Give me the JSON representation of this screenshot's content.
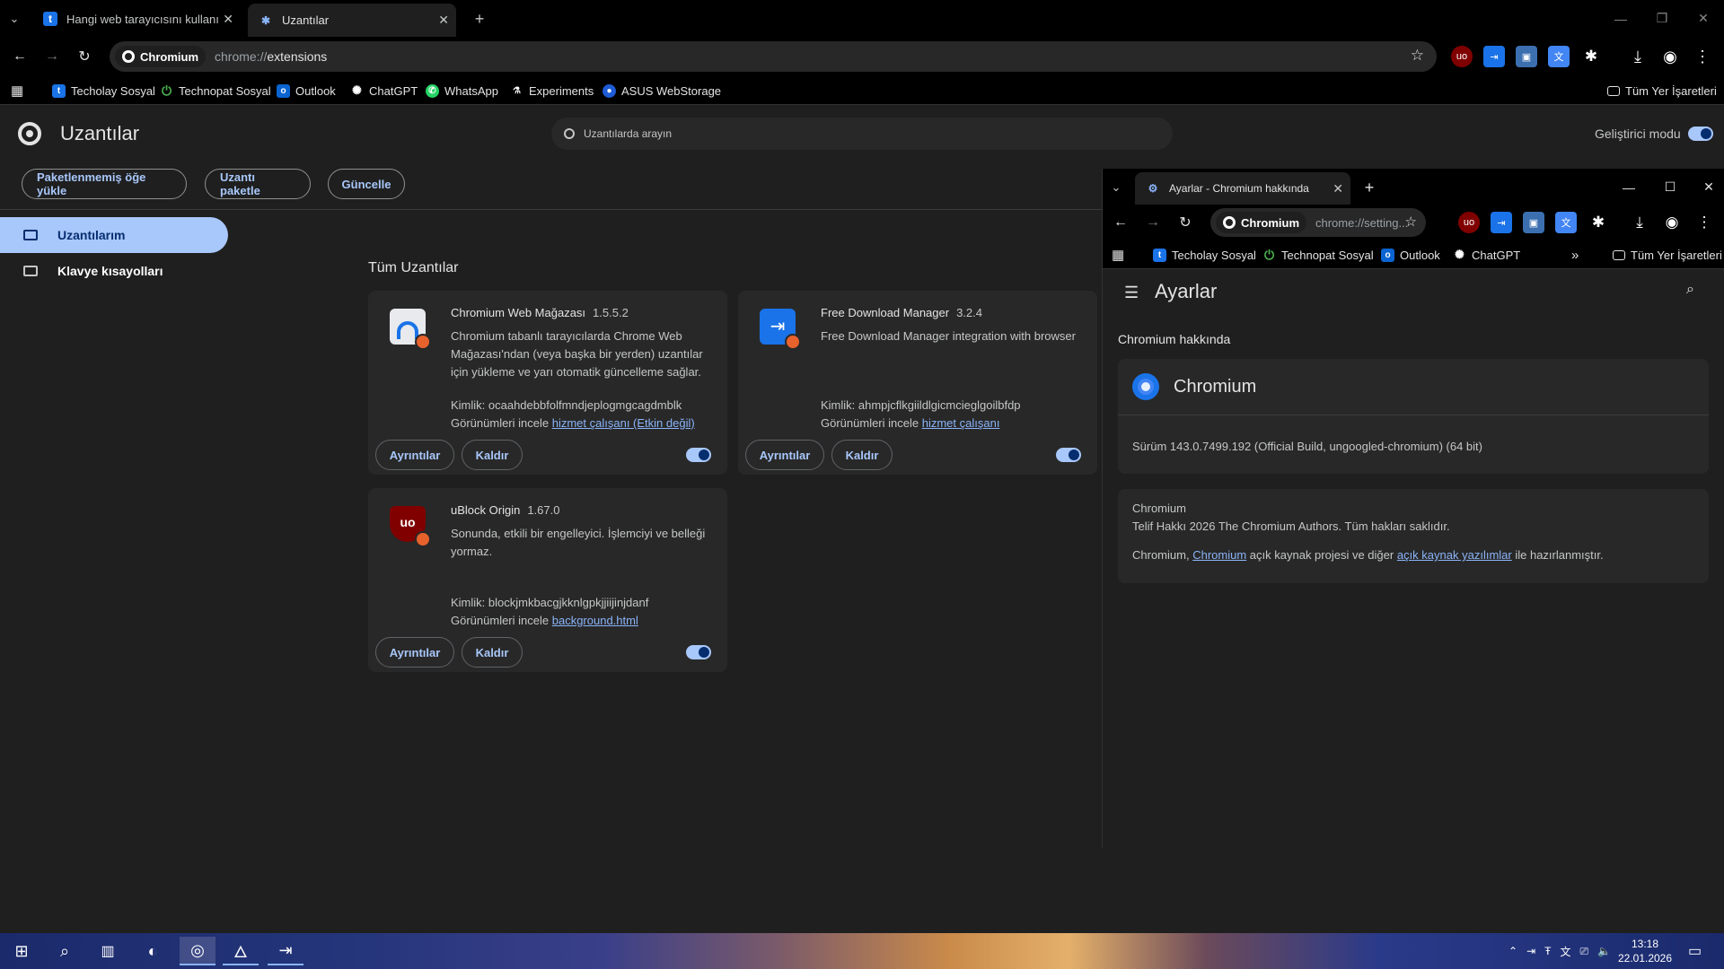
{
  "tabs": [
    {
      "title": "Hangi web tarayıcısını kullanıyo"
    },
    {
      "title": "Uzantılar"
    }
  ],
  "omnibox": {
    "chip": "Chromium",
    "url_prefix": "chrome://",
    "url_path": "extensions"
  },
  "bookmarks": [
    "Techolay Sosyal",
    "Technopat Sosyal",
    "Outlook",
    "ChatGPT",
    "WhatsApp",
    "Experiments",
    "ASUS WebStorage"
  ],
  "all_bookmarks": "Tüm Yer İşaretleri",
  "page": {
    "title": "Uzantılar",
    "search_placeholder": "Uzantılarda arayın",
    "dev_mode_label": "Geliştirici modu",
    "dev_mode_on": true,
    "buttons": [
      "Paketlenmemiş öğe yükle",
      "Uzantı paketle",
      "Güncelle"
    ],
    "sidebar": [
      {
        "label": "Uzantılarım",
        "active": true
      },
      {
        "label": "Klavye kısayolları",
        "active": false
      }
    ],
    "section_title": "Tüm Uzantılar"
  },
  "extensions": [
    {
      "name": "Chromium Web Mağazası",
      "version": "1.5.5.2",
      "description": "Chromium tabanlı tarayıcılarda Chrome Web Mağazası'ndan (veya başka bir yerden) uzantılar için yükleme ve yarı otomatik güncelleme sağlar.",
      "id_label": "Kimlik: ocaahdebbfolfmndjeplogmgcagdmblk",
      "views_label": "Görünümleri incele",
      "views_link": "hizmet çalışanı (Etkin değil)",
      "details": "Ayrıntılar",
      "remove": "Kaldır",
      "enabled": true
    },
    {
      "name": "Free Download Manager",
      "version": "3.2.4",
      "description": "Free Download Manager integration with browser",
      "id_label": "Kimlik: ahmpjcflkgiildlgicmcieglgoilbfdp",
      "views_label": "Görünümleri incele",
      "views_link": "hizmet çalışanı",
      "details": "Ayrıntılar",
      "remove": "Kaldır",
      "enabled": true
    },
    {
      "name": "uBlock Origin",
      "version": "1.67.0",
      "description": "Sonunda, etkili bir engelleyici. İşlemciyi ve belleği yormaz.",
      "id_label": "Kimlik: blockjmkbacgjkknlgpkjjiijinjdanf",
      "views_label": "Görünümleri incele",
      "views_link": "background.html",
      "details": "Ayrıntılar",
      "remove": "Kaldır",
      "enabled": true
    }
  ],
  "popup": {
    "tab_title": "Ayarlar - Chromium hakkında",
    "chip": "Chromium",
    "url": "chrome://setting...",
    "bookmarks": [
      "Techolay Sosyal",
      "Technopat Sosyal",
      "Outlook",
      "ChatGPT"
    ],
    "all_bookmarks": "Tüm Yer İşaretleri",
    "settings_title": "Ayarlar",
    "section": "Chromium hakkında",
    "product": "Chromium",
    "version": "Sürüm 143.0.7499.192 (Official Build, ungoogled-chromium) (64 bit)",
    "about_name": "Chromium",
    "copyright": "Telif Hakkı 2026 The Chromium Authors. Tüm hakları saklıdır.",
    "credit_pre": "Chromium,",
    "credit_link1": "Chromium",
    "credit_mid": "açık kaynak projesi ve diğer",
    "credit_link2": "açık kaynak yazılımlar",
    "credit_post": "ile hazırlanmıştır."
  },
  "taskbar": {
    "time": "13:18",
    "date": "22.01.2026"
  },
  "colors": {
    "accent": "#a8c7fa",
    "badge": "#e8622c"
  }
}
